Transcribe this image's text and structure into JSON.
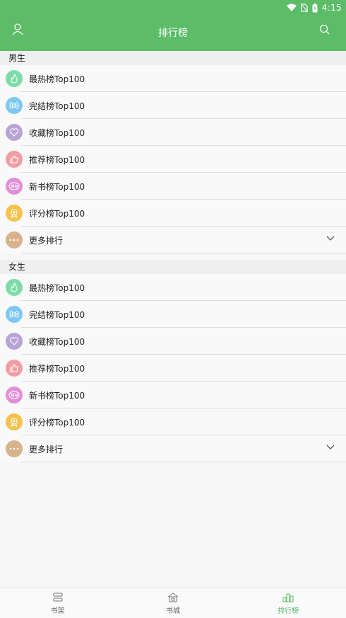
{
  "status_bar": {
    "time": "4:15"
  },
  "header": {
    "title": "排行榜"
  },
  "colors": {
    "accent": "#5cbc68",
    "hot": "#7ddca6",
    "finished": "#7ec8f2",
    "favorite": "#b8a3d6",
    "recommend": "#f39da2",
    "new": "#e38fd6",
    "rating": "#f5c24d",
    "more": "#d8b28b"
  },
  "sections": [
    {
      "title": "男生",
      "items": [
        {
          "label": "最热榜Top100",
          "icon": "fire-icon"
        },
        {
          "label": "完结榜Top100",
          "icon": "command-icon"
        },
        {
          "label": "收藏榜Top100",
          "icon": "heart-icon"
        },
        {
          "label": "推荐榜Top100",
          "icon": "thumbs-up-icon"
        },
        {
          "label": "新书榜Top100",
          "icon": "new-badge-icon"
        },
        {
          "label": "评分榜Top100",
          "icon": "award-icon"
        },
        {
          "label": "更多排行",
          "icon": "more-dots-icon"
        }
      ]
    },
    {
      "title": "女生",
      "items": [
        {
          "label": "最热榜Top100",
          "icon": "fire-icon"
        },
        {
          "label": "完结榜Top100",
          "icon": "command-icon"
        },
        {
          "label": "收藏榜Top100",
          "icon": "heart-icon"
        },
        {
          "label": "推荐榜Top100",
          "icon": "thumbs-up-icon"
        },
        {
          "label": "新书榜Top100",
          "icon": "new-badge-icon"
        },
        {
          "label": "评分榜Top100",
          "icon": "award-icon"
        },
        {
          "label": "更多排行",
          "icon": "more-dots-icon"
        }
      ]
    }
  ],
  "bottom_nav": [
    {
      "label": "书架",
      "icon": "bookshelf-icon",
      "active": false
    },
    {
      "label": "书城",
      "icon": "bookstore-icon",
      "active": false
    },
    {
      "label": "排行榜",
      "icon": "ranking-icon",
      "active": true
    }
  ]
}
